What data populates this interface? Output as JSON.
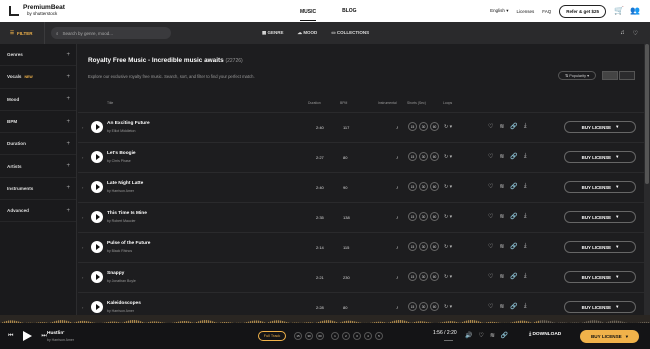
{
  "brand": {
    "name": "PremiumBeat",
    "byline": "by shutterstock"
  },
  "nav": {
    "music": "MUSIC",
    "blog": "BLOG"
  },
  "top_right": {
    "language": "English",
    "licenses": "Licenses",
    "faq": "FAQ",
    "refer": "Refer & get $25"
  },
  "toolbar": {
    "filter": "FILTER",
    "search_placeholder": "Search by genre, mood...",
    "genre": "GENRE",
    "mood": "MOOD",
    "collections": "COLLECTIONS"
  },
  "sidebar": {
    "items": [
      {
        "label": "Genres"
      },
      {
        "label": "Vocals",
        "badge": "NEW"
      },
      {
        "label": "Mood"
      },
      {
        "label": "BPM"
      },
      {
        "label": "Duration"
      },
      {
        "label": "Artists"
      },
      {
        "label": "Instruments"
      },
      {
        "label": "Advanced"
      }
    ]
  },
  "page": {
    "title": "Royalty Free Music - Incredible music awaits",
    "count": "(22726)",
    "subtitle": "Explore our exclusive royalty free music. Search, sort, and filter to find your perfect match.",
    "sort": "Popularity"
  },
  "columns": {
    "title": "Title",
    "duration": "Duration",
    "bpm": "BPM",
    "instrumental": "Instrumental",
    "shorts": "Shorts (Sec)",
    "loops": "Loops"
  },
  "shorts": [
    "15",
    "30",
    "60"
  ],
  "buy_label": "BUY LICENSE",
  "tracks": [
    {
      "title": "An Exciting Future",
      "artist": "by Elliot Middleton",
      "duration": "2:40",
      "bpm": "117"
    },
    {
      "title": "Let's Boogie",
      "artist": "by Chris Phase",
      "duration": "2:27",
      "bpm": "80"
    },
    {
      "title": "Late Night Latte",
      "artist": "by Harrison Amer",
      "duration": "2:40",
      "bpm": "90"
    },
    {
      "title": "This Time Is Mine",
      "artist": "by Robert Maucier",
      "duration": "2:35",
      "bpm": "138"
    },
    {
      "title": "Pulse of the Future",
      "artist": "by Black Rhinos",
      "duration": "2:14",
      "bpm": "115"
    },
    {
      "title": "Snappy",
      "artist": "by Jonathan Boyle",
      "duration": "2:21",
      "bpm": "230"
    },
    {
      "title": "Kaleidoscopes",
      "artist": "by Harrison Amer",
      "duration": "2:28",
      "bpm": "80"
    }
  ],
  "player": {
    "title": "Hustlin'",
    "artist": "by Harrison Amer",
    "full_track": "Full Track",
    "shorts": [
      "15",
      "30",
      "60"
    ],
    "loops": [
      "1",
      "2",
      "3",
      "4",
      "5"
    ],
    "time": "1:56 / 2:20",
    "download": "DOWNLOAD",
    "buy": "BUY LICENSE"
  },
  "colors": {
    "accent": "#f0b24a",
    "background": "#1d1d1f"
  }
}
